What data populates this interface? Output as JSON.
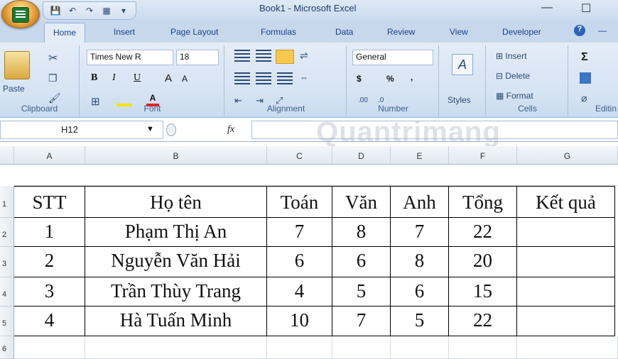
{
  "window": {
    "title": "Book1 - Microsoft Excel",
    "minimize": "—",
    "maximize": "☐"
  },
  "tabs": [
    "Home",
    "Insert",
    "Page Layout",
    "Formulas",
    "Data",
    "Review",
    "View",
    "Developer"
  ],
  "ribbon": {
    "clipboard": {
      "paste": "Paste",
      "label": "Clipboard"
    },
    "font": {
      "name": "Times New R",
      "size": "18",
      "label": "Font",
      "bold": "B",
      "italic": "I",
      "underline": "U",
      "grow": "A",
      "shrink": "A"
    },
    "alignment": {
      "label": "Alignment"
    },
    "number": {
      "format": "General",
      "currency": "$",
      "percent": "%",
      "comma": ",",
      "inc": ".00",
      "dec": ".0",
      "label": "Number"
    },
    "styles": {
      "label": "Styles"
    },
    "cells": {
      "insert": "Insert",
      "delete": "Delete",
      "format": "Format",
      "label": "Cells"
    },
    "editing": {
      "sum": "Σ",
      "label": "Editin"
    }
  },
  "formula_bar": {
    "cell": "H12",
    "fx": "fx"
  },
  "watermark": "Quantrimang",
  "columns": [
    "A",
    "B",
    "C",
    "D",
    "E",
    "F",
    "G"
  ],
  "rows": [
    "1",
    "2",
    "3",
    "4",
    "5",
    "6"
  ],
  "table": {
    "header": [
      "STT",
      "Họ tên",
      "Toán",
      "Văn",
      "Anh",
      "Tổng",
      "Kết quả"
    ],
    "data": [
      [
        "1",
        "Phạm Thị An",
        "7",
        "8",
        "7",
        "22",
        ""
      ],
      [
        "2",
        "Nguyễn Văn Hải",
        "6",
        "6",
        "8",
        "20",
        ""
      ],
      [
        "3",
        "Trần Thùy Trang",
        "4",
        "5",
        "6",
        "15",
        ""
      ],
      [
        "4",
        "Hà Tuấn Minh",
        "10",
        "7",
        "5",
        "22",
        ""
      ]
    ]
  }
}
